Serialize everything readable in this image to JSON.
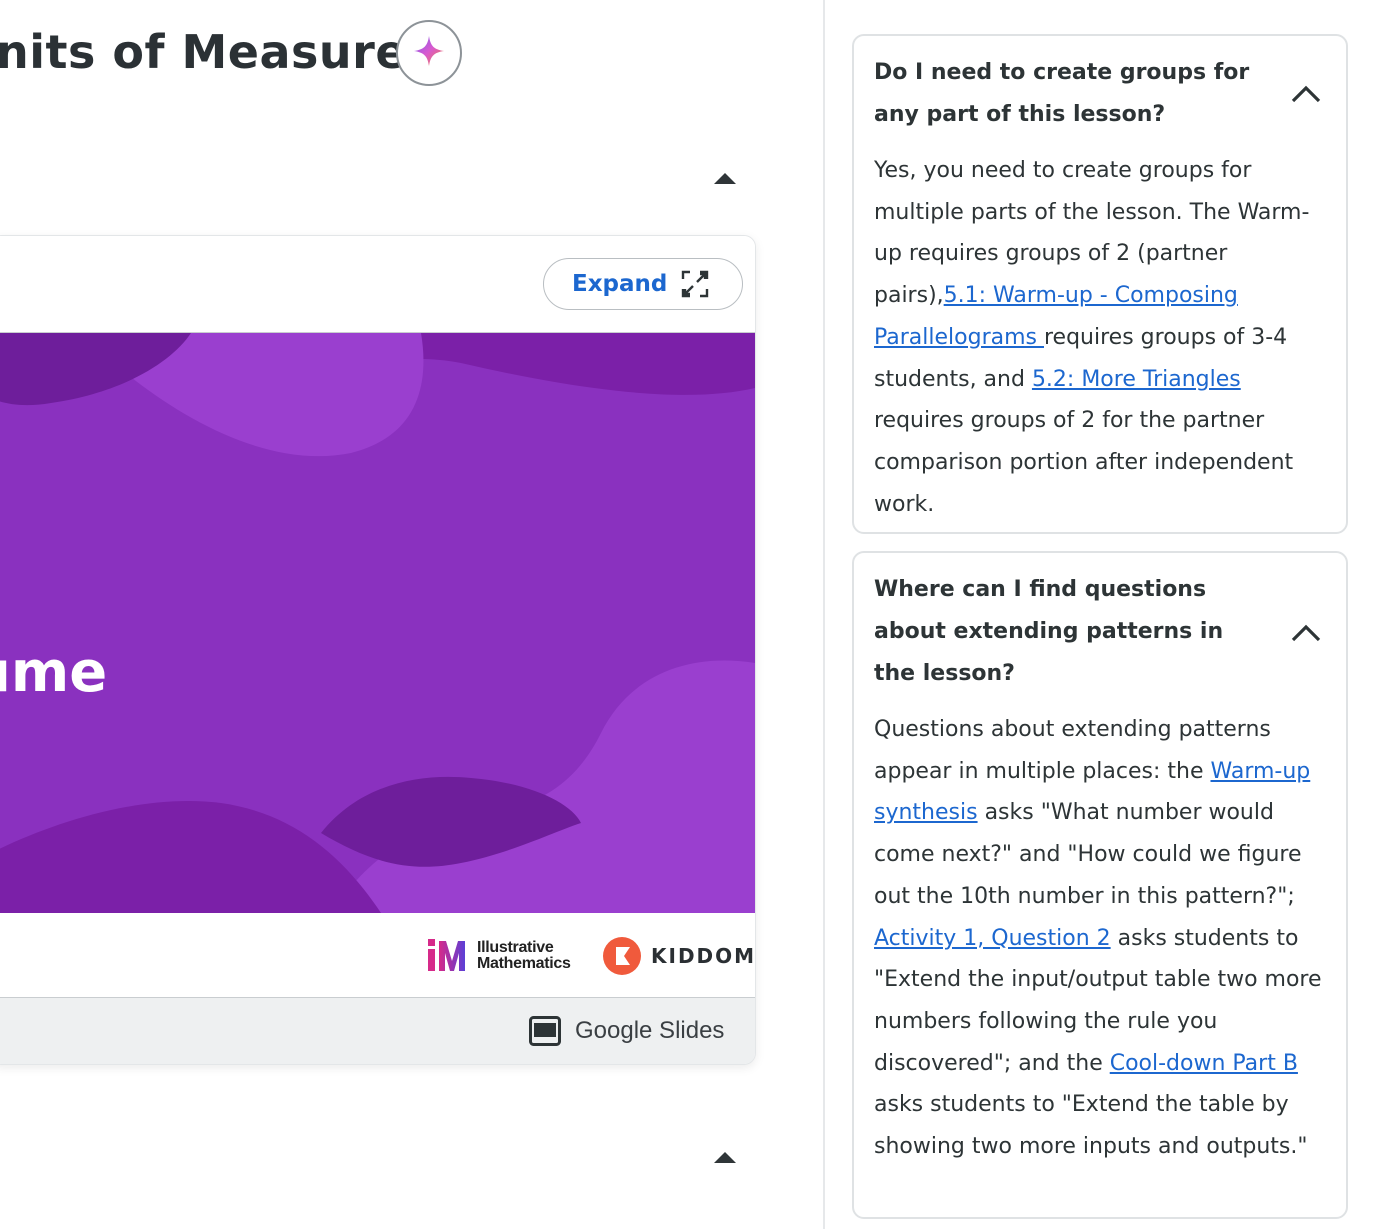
{
  "header": {
    "title": "nits of Measure"
  },
  "slides": {
    "expand_label": "Expand",
    "slide_title": "ume",
    "brand_im": [
      "Illustrative",
      "Mathematics"
    ],
    "brand_kiddom": "KIDDOM",
    "footer_label": "Google Slides",
    "slide_color": "#8a31bf"
  },
  "faq": [
    {
      "question": "Do I need to create groups for any part of this lesson?",
      "answer": [
        {
          "t": "Yes, you need to create groups for multiple parts of the lesson. The Warm-up requires groups of 2 (partner pairs),"
        },
        {
          "t": "5.1: Warm-up - Composing Parallelograms ",
          "link": true
        },
        {
          "t": " requires groups of 3-4 students, and "
        },
        {
          "t": "5.2: More Triangles",
          "link": true
        },
        {
          "t": " requires groups of 2 for the partner comparison portion after independent work."
        }
      ]
    },
    {
      "question": "Where can I find questions about extending patterns in the lesson?",
      "answer": [
        {
          "t": "Questions about extending patterns appear in multiple places: the "
        },
        {
          "t": "Warm-up synthesis",
          "link": true
        },
        {
          "t": " asks \"What number would come next?\" and \"How could we figure out the 10th number in this pattern?\"; "
        },
        {
          "t": "Activity 1, Question 2",
          "link": true
        },
        {
          "t": " asks students to \"Extend the input/output table two more numbers following the rule you discovered\"; and the "
        },
        {
          "t": "Cool-down Part B",
          "link": true
        },
        {
          "t": " asks students to \"Extend the table by showing two more inputs and outputs.\""
        }
      ]
    }
  ],
  "colors": {
    "link": "#1c67cf",
    "text": "#2d3436",
    "accent_star": "#c25ad6"
  },
  "icons": [
    "sparkle-icon",
    "caret-up-icon",
    "expand-icon",
    "chevron-up-icon",
    "google-slides-icon"
  ]
}
